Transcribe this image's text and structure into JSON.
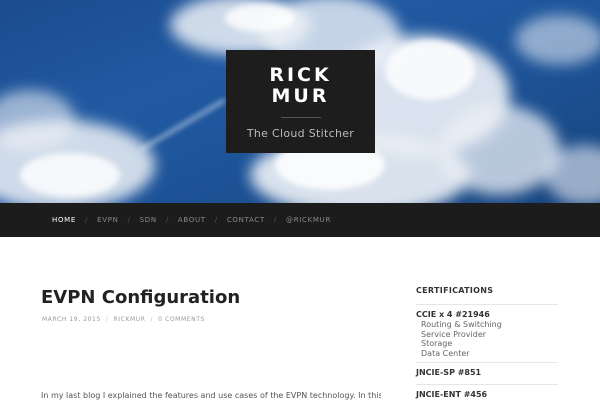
{
  "site": {
    "title_line1": "RICK",
    "title_line2": "MUR",
    "tagline": "The Cloud Stitcher"
  },
  "nav": {
    "items": [
      {
        "label": "HOME",
        "active": true
      },
      {
        "label": "EVPN",
        "active": false
      },
      {
        "label": "SDN",
        "active": false
      },
      {
        "label": "ABOUT",
        "active": false
      },
      {
        "label": "CONTACT",
        "active": false
      },
      {
        "label": "@RICKMUR",
        "active": false
      }
    ],
    "separator": "/"
  },
  "post": {
    "title": "EVPN Configuration",
    "date": "MARCH 19, 2015",
    "author": "RICKMUR",
    "comments": "0 COMMENTS",
    "meta_separator": "/",
    "excerpt": "In my last blog I explained the features and use cases of the EVPN technology. In this blog I"
  },
  "sidebar": {
    "widget_title": "CERTIFICATIONS",
    "ccie": {
      "title": "CCIE x 4 #21946",
      "tracks": [
        "Routing & Switching",
        "Service Provider",
        "Storage",
        "Data Center"
      ]
    },
    "jncie_sp": "JNCIE-SP #851",
    "jncie_ent": "JNCIE-ENT #456"
  },
  "colors": {
    "sky": "#1d5398",
    "brand_box": "#1d1d1d",
    "nav_bg": "#1c1c1c"
  }
}
